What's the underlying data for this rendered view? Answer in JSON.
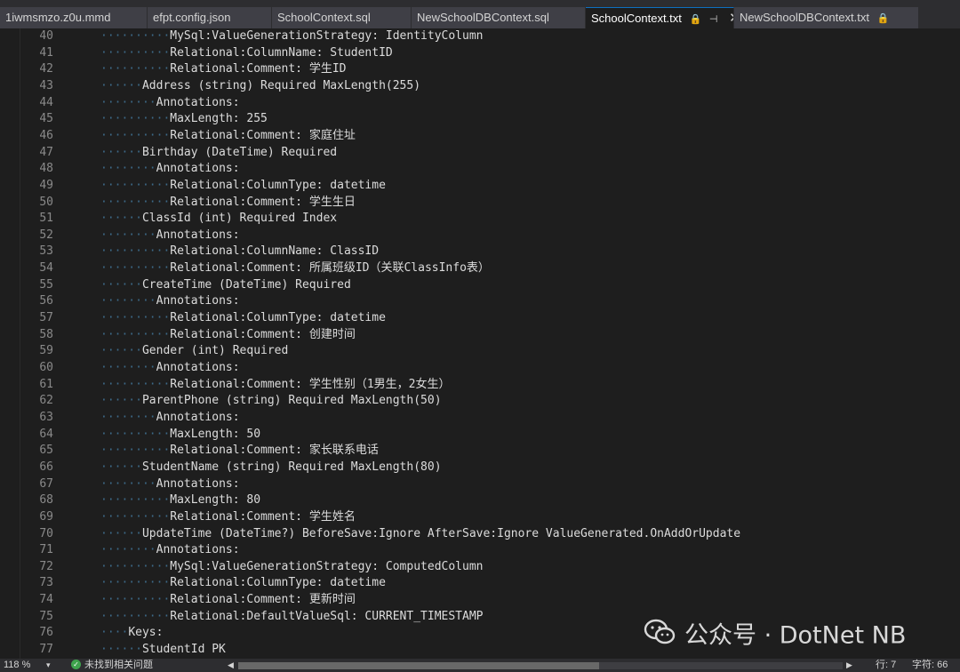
{
  "tabs": [
    {
      "label": "1iwmsmzo.z0u.mmd",
      "active": false,
      "locked": false,
      "pinned": false,
      "closable": false
    },
    {
      "label": "efpt.config.json",
      "active": false,
      "locked": false,
      "pinned": false,
      "closable": false
    },
    {
      "label": "SchoolContext.sql",
      "active": false,
      "locked": false,
      "pinned": false,
      "closable": false
    },
    {
      "label": "NewSchoolDBContext.sql",
      "active": false,
      "locked": false,
      "pinned": false,
      "closable": false
    },
    {
      "label": "SchoolContext.txt",
      "active": true,
      "locked": true,
      "pinned": true,
      "closable": true
    },
    {
      "label": "NewSchoolDBContext.txt",
      "active": false,
      "locked": true,
      "pinned": false,
      "closable": false
    }
  ],
  "tab_icons": {
    "lock": "🔒",
    "pin": "⊣",
    "close": "✕"
  },
  "editor": {
    "lines": [
      {
        "number": "40",
        "dots": "··········",
        "text": "MySql:ValueGenerationStrategy: IdentityColumn"
      },
      {
        "number": "41",
        "dots": "··········",
        "text": "Relational:ColumnName: StudentID"
      },
      {
        "number": "42",
        "dots": "··········",
        "text": "Relational:Comment: 学生ID"
      },
      {
        "number": "43",
        "dots": "······",
        "text": "Address (string) Required MaxLength(255)"
      },
      {
        "number": "44",
        "dots": "········",
        "text": "Annotations:"
      },
      {
        "number": "45",
        "dots": "··········",
        "text": "MaxLength: 255"
      },
      {
        "number": "46",
        "dots": "··········",
        "text": "Relational:Comment: 家庭住址"
      },
      {
        "number": "47",
        "dots": "······",
        "text": "Birthday (DateTime) Required"
      },
      {
        "number": "48",
        "dots": "········",
        "text": "Annotations:"
      },
      {
        "number": "49",
        "dots": "··········",
        "text": "Relational:ColumnType: datetime"
      },
      {
        "number": "50",
        "dots": "··········",
        "text": "Relational:Comment: 学生生日"
      },
      {
        "number": "51",
        "dots": "······",
        "text": "ClassId (int) Required Index"
      },
      {
        "number": "52",
        "dots": "········",
        "text": "Annotations:"
      },
      {
        "number": "53",
        "dots": "··········",
        "text": "Relational:ColumnName: ClassID"
      },
      {
        "number": "54",
        "dots": "··········",
        "text": "Relational:Comment: 所属班级ID（关联ClassInfo表）"
      },
      {
        "number": "55",
        "dots": "······",
        "text": "CreateTime (DateTime) Required"
      },
      {
        "number": "56",
        "dots": "········",
        "text": "Annotations:"
      },
      {
        "number": "57",
        "dots": "··········",
        "text": "Relational:ColumnType: datetime"
      },
      {
        "number": "58",
        "dots": "··········",
        "text": "Relational:Comment: 创建时间"
      },
      {
        "number": "59",
        "dots": "······",
        "text": "Gender (int) Required"
      },
      {
        "number": "60",
        "dots": "········",
        "text": "Annotations:"
      },
      {
        "number": "61",
        "dots": "··········",
        "text": "Relational:Comment: 学生性别（1男生，2女生）"
      },
      {
        "number": "62",
        "dots": "······",
        "text": "ParentPhone (string) Required MaxLength(50)"
      },
      {
        "number": "63",
        "dots": "········",
        "text": "Annotations:"
      },
      {
        "number": "64",
        "dots": "··········",
        "text": "MaxLength: 50"
      },
      {
        "number": "65",
        "dots": "··········",
        "text": "Relational:Comment: 家长联系电话"
      },
      {
        "number": "66",
        "dots": "······",
        "text": "StudentName (string) Required MaxLength(80)"
      },
      {
        "number": "67",
        "dots": "········",
        "text": "Annotations:"
      },
      {
        "number": "68",
        "dots": "··········",
        "text": "MaxLength: 80"
      },
      {
        "number": "69",
        "dots": "··········",
        "text": "Relational:Comment: 学生姓名"
      },
      {
        "number": "70",
        "dots": "······",
        "text": "UpdateTime (DateTime?) BeforeSave:Ignore AfterSave:Ignore ValueGenerated.OnAddOrUpdate"
      },
      {
        "number": "71",
        "dots": "········",
        "text": "Annotations:"
      },
      {
        "number": "72",
        "dots": "··········",
        "text": "MySql:ValueGenerationStrategy: ComputedColumn"
      },
      {
        "number": "73",
        "dots": "··········",
        "text": "Relational:ColumnType: datetime"
      },
      {
        "number": "74",
        "dots": "··········",
        "text": "Relational:Comment: 更新时间"
      },
      {
        "number": "75",
        "dots": "··········",
        "text": "Relational:DefaultValueSql: CURRENT_TIMESTAMP"
      },
      {
        "number": "76",
        "dots": "····",
        "text": "Keys:"
      },
      {
        "number": "77",
        "dots": "······",
        "text": "StudentId PK"
      }
    ]
  },
  "watermark": {
    "text": "公众号 · DotNet NB",
    "icon": "wechat-icon"
  },
  "status": {
    "zoom": "118 %",
    "issues": "未找到相关问题",
    "line": "行: 7",
    "col": "字符: 66",
    "hscroll_position": 0.6
  },
  "colors": {
    "background": "#1e1e1e",
    "text": "#dcdcdc",
    "line_number": "#8a8a8a",
    "whitespace_dot": "#3d6b8a",
    "tab_inactive": "#3f3f46",
    "accent": "#0e70c0",
    "ok_green": "#3fa34d"
  }
}
